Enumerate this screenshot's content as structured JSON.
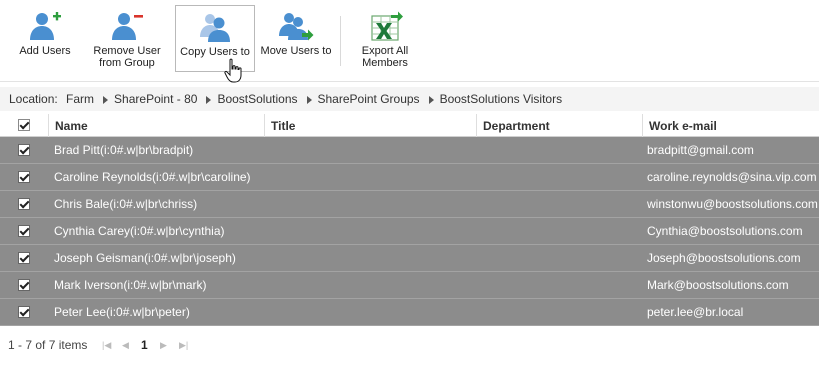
{
  "ribbon": {
    "add_users": "Add Users",
    "remove_user_line1": "Remove User",
    "remove_user_line2": "from Group",
    "copy_users": "Copy Users to",
    "move_users": "Move Users to",
    "export_line1": "Export All",
    "export_line2": "Members"
  },
  "location": {
    "label": "Location:",
    "crumbs": [
      "Farm",
      "SharePoint - 80",
      "BoostSolutions",
      "SharePoint Groups",
      "BoostSolutions Visitors"
    ]
  },
  "grid": {
    "columns": [
      "Name",
      "Title",
      "Department",
      "Work e-mail"
    ],
    "rows": [
      {
        "name": "Brad Pitt(i:0#.w|br\\bradpit)",
        "title": "",
        "department": "",
        "email": "bradpitt@gmail.com"
      },
      {
        "name": "Caroline Reynolds(i:0#.w|br\\caroline)",
        "title": "",
        "department": "",
        "email": "caroline.reynolds@sina.vip.com"
      },
      {
        "name": "Chris Bale(i:0#.w|br\\chriss)",
        "title": "",
        "department": "",
        "email": "winstonwu@boostsolutions.com"
      },
      {
        "name": "Cynthia Carey(i:0#.w|br\\cynthia)",
        "title": "",
        "department": "",
        "email": "Cynthia@boostsolutions.com"
      },
      {
        "name": "Joseph Geisman(i:0#.w|br\\joseph)",
        "title": "",
        "department": "",
        "email": "Joseph@boostsolutions.com"
      },
      {
        "name": "Mark Iverson(i:0#.w|br\\mark)",
        "title": "",
        "department": "",
        "email": "Mark@boostsolutions.com"
      },
      {
        "name": "Peter Lee(i:0#.w|br\\peter)",
        "title": "",
        "department": "",
        "email": "peter.lee@br.local"
      }
    ]
  },
  "pager": {
    "summary": "1 - 7 of 7 items",
    "current_page": "1"
  },
  "colors": {
    "selected_row": "#8c8c8c",
    "user_icon": "#4a8fd0",
    "add_accent": "#2e9e3e",
    "remove_accent": "#d9342b",
    "excel_green": "#1e7a3a"
  }
}
